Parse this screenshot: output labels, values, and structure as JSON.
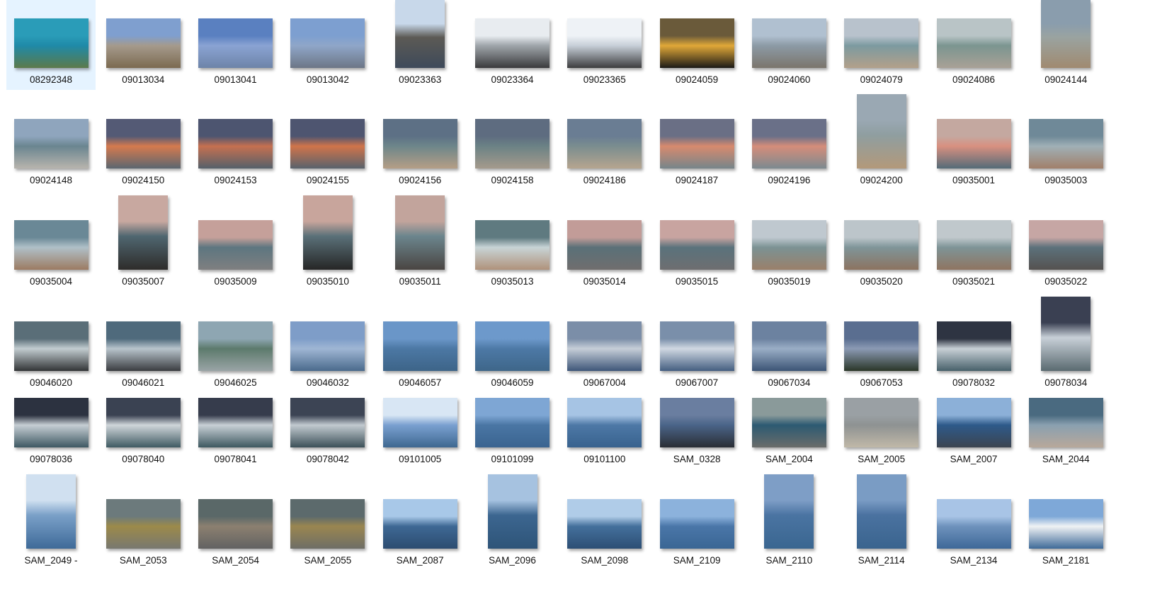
{
  "view": "large-icons",
  "selected_index": 0,
  "rows": [
    [
      [
        "08292348",
        "l",
        [
          "#2a9cb8",
          "#1f8aa8",
          "#5d7a4a"
        ]
      ],
      [
        "09013034",
        "l",
        [
          "#7f9fcf",
          "#a59a8c",
          "#7b6a50"
        ]
      ],
      [
        "09013041",
        "l",
        [
          "#5a80c0",
          "#8aa3d3",
          "#6d84a8"
        ]
      ],
      [
        "09013042",
        "l",
        [
          "#7d9fd0",
          "#8fa6c8",
          "#6c7686"
        ]
      ],
      [
        "09023363",
        "p",
        [
          "#c8d8ea",
          "#5c5a55",
          "#3e4a5a"
        ]
      ],
      [
        "09023364",
        "l",
        [
          "#e8ecf0",
          "#9fa5aa",
          "#3a3a3c"
        ]
      ],
      [
        "09023365",
        "l",
        [
          "#eef2f6",
          "#c7cfd8",
          "#3c3c3e"
        ]
      ],
      [
        "09024059",
        "l",
        [
          "#6a5a3a",
          "#e0a838",
          "#1b1a17"
        ]
      ],
      [
        "09024060",
        "l",
        [
          "#b0c0d0",
          "#8c9aa5",
          "#7b756c"
        ]
      ],
      [
        "09024079",
        "l",
        [
          "#b8c2cc",
          "#7c9aa0",
          "#b3a08a"
        ]
      ],
      [
        "09024086",
        "l",
        [
          "#b9c4c6",
          "#7b9590",
          "#a9a196"
        ]
      ],
      [
        "09024144",
        "p",
        [
          "#8a9dad",
          "#9aa3a0",
          "#a08a70"
        ]
      ]
    ],
    [
      [
        "09024148",
        "l",
        [
          "#8fa5bd",
          "#6a8590",
          "#b8b4ad"
        ]
      ],
      [
        "09024150",
        "l",
        [
          "#545a75",
          "#d57a4e",
          "#5b6670"
        ]
      ],
      [
        "09024153",
        "l",
        [
          "#4d5570",
          "#c57050",
          "#55606a"
        ]
      ],
      [
        "09024155",
        "l",
        [
          "#4e5570",
          "#d0744a",
          "#58626c"
        ]
      ],
      [
        "09024156",
        "l",
        [
          "#5d7085",
          "#6d868a",
          "#b59e86"
        ]
      ],
      [
        "09024158",
        "l",
        [
          "#5e6c80",
          "#6b8285",
          "#a59a8c"
        ]
      ],
      [
        "09024186",
        "l",
        [
          "#6a7d93",
          "#7a8d8f",
          "#b6a58f"
        ]
      ],
      [
        "09024187",
        "l",
        [
          "#6a6f85",
          "#d78a6e",
          "#76858a"
        ]
      ],
      [
        "09024196",
        "l",
        [
          "#6a7088",
          "#d58d7a",
          "#7c8a90"
        ]
      ],
      [
        "09024200",
        "p",
        [
          "#9aa8b3",
          "#8f9ea0",
          "#b3997a"
        ]
      ],
      [
        "09035001",
        "l",
        [
          "#c4a8a0",
          "#d89080",
          "#546b78"
        ]
      ],
      [
        "09035003",
        "l",
        [
          "#6f8998",
          "#a0b0b6",
          "#a1806a"
        ]
      ]
    ],
    [
      [
        "09035004",
        "l",
        [
          "#6a8896",
          "#b0c0c8",
          "#9c7b62"
        ]
      ],
      [
        "09035007",
        "p",
        [
          "#c8a8a0",
          "#4f6670",
          "#2e2c2a"
        ]
      ],
      [
        "09035009",
        "l",
        [
          "#c5a09a",
          "#5d7680",
          "#7f7f80"
        ]
      ],
      [
        "09035010",
        "p",
        [
          "#c8a59c",
          "#5a7078",
          "#262626"
        ]
      ],
      [
        "09035011",
        "p",
        [
          "#c2a49c",
          "#6b858d",
          "#4a4542"
        ]
      ],
      [
        "09035013",
        "l",
        [
          "#5f7a80",
          "#c8d4d6",
          "#b0927b"
        ]
      ],
      [
        "09035014",
        "l",
        [
          "#c29c98",
          "#5a7078",
          "#706e6e"
        ]
      ],
      [
        "09035015",
        "l",
        [
          "#c8a4a0",
          "#5a727c",
          "#6e6e70"
        ]
      ],
      [
        "09035019",
        "l",
        [
          "#bfc8cf",
          "#7b9294",
          "#9a806a"
        ]
      ],
      [
        "09035020",
        "l",
        [
          "#bcc5ca",
          "#7f9599",
          "#8c7360"
        ]
      ],
      [
        "09035021",
        "l",
        [
          "#c0c8cc",
          "#7e9497",
          "#8f7561"
        ]
      ],
      [
        "09035022",
        "l",
        [
          "#c6a6a4",
          "#5c717b",
          "#555250"
        ]
      ]
    ],
    [
      [
        "09046020",
        "l",
        [
          "#5a6e78",
          "#c2ccd0",
          "#323436"
        ]
      ],
      [
        "09046021",
        "l",
        [
          "#4f6a7c",
          "#b8c4cc",
          "#3a3c40"
        ]
      ],
      [
        "09046025",
        "l",
        [
          "#8ea6b2",
          "#5c7a6c",
          "#9aa4a6"
        ]
      ],
      [
        "09046032",
        "l",
        [
          "#7e9dc8",
          "#9fb6d4",
          "#4a6a8c"
        ]
      ],
      [
        "09046057",
        "l",
        [
          "#6a96c8",
          "#4c78a4",
          "#3d6488"
        ]
      ],
      [
        "09046059",
        "l",
        [
          "#6d99cb",
          "#4d79a6",
          "#3e6689"
        ]
      ],
      [
        "09067004",
        "l",
        [
          "#7b8ea8",
          "#c6ced8",
          "#3e5678"
        ]
      ],
      [
        "09067007",
        "l",
        [
          "#7a8faa",
          "#d0d8e2",
          "#445e80"
        ]
      ],
      [
        "09067034",
        "l",
        [
          "#6c82a0",
          "#9aaec6",
          "#3b5475"
        ]
      ],
      [
        "09067053",
        "l",
        [
          "#5a6e90",
          "#8b9ab4",
          "#2a3628"
        ]
      ],
      [
        "09078032",
        "l",
        [
          "#2e3442",
          "#c8d0d6",
          "#47606a"
        ]
      ],
      [
        "09078034",
        "p",
        [
          "#3a4052",
          "#c8d0d8",
          "#5a6a70"
        ]
      ]
    ],
    [
      [
        "09078036",
        "l",
        [
          "#2c3240",
          "#c6ced4",
          "#3e5862"
        ]
      ],
      [
        "09078040",
        "l",
        [
          "#3a4252",
          "#d0d6da",
          "#3f5a62"
        ]
      ],
      [
        "09078041",
        "l",
        [
          "#363c4c",
          "#c8d0d6",
          "#3e5860"
        ]
      ],
      [
        "09078042",
        "l",
        [
          "#3c4454",
          "#c2cad0",
          "#3c5058"
        ]
      ],
      [
        "09101005",
        "l",
        [
          "#d8e6f4",
          "#7aa0d0",
          "#3e6890"
        ]
      ],
      [
        "09101099",
        "l",
        [
          "#7ea6d4",
          "#4a76a4",
          "#3a6490"
        ]
      ],
      [
        "09101100",
        "l",
        [
          "#a6c4e4",
          "#4d78a6",
          "#38628e"
        ]
      ],
      [
        "SAM_0328",
        "l",
        [
          "#6a7ea0",
          "#4a6488",
          "#2a2e34"
        ]
      ],
      [
        "SAM_2004",
        "l",
        [
          "#8a9a9a",
          "#2c5a72",
          "#6a6c6a"
        ]
      ],
      [
        "SAM_2005",
        "l",
        [
          "#9aa0a4",
          "#8e9292",
          "#c0b8a8"
        ]
      ],
      [
        "SAM_2007",
        "l",
        [
          "#8cb0d8",
          "#2e5a8a",
          "#3c4450"
        ]
      ],
      [
        "SAM_2044",
        "l",
        [
          "#4a6a80",
          "#8aa0b0",
          "#b8a89a"
        ]
      ]
    ],
    [
      [
        "SAM_2049 -",
        "p",
        [
          "#d0e0f0",
          "#7aa0c8",
          "#3e6a98"
        ]
      ],
      [
        "SAM_2053",
        "l",
        [
          "#6c7a7c",
          "#9c8a4a",
          "#787870"
        ]
      ],
      [
        "SAM_2054",
        "l",
        [
          "#5a6868",
          "#8c8070",
          "#626262"
        ]
      ],
      [
        "SAM_2055",
        "l",
        [
          "#5c6a6c",
          "#9a8650",
          "#6e6e66"
        ]
      ],
      [
        "SAM_2087",
        "l",
        [
          "#a8c8e8",
          "#3e6894",
          "#2c4c70"
        ]
      ],
      [
        "SAM_2096",
        "p",
        [
          "#a6c2e0",
          "#3c6690",
          "#2e5478"
        ]
      ],
      [
        "SAM_2098",
        "l",
        [
          "#b0cce8",
          "#44709c",
          "#2c4e74"
        ]
      ],
      [
        "SAM_2109",
        "l",
        [
          "#8cb2dc",
          "#4a76a8",
          "#3a6694"
        ]
      ],
      [
        "SAM_2110",
        "p",
        [
          "#7e9ec6",
          "#4a74a2",
          "#3a6690"
        ]
      ],
      [
        "SAM_2114",
        "p",
        [
          "#7a9cc4",
          "#4a72a0",
          "#3a648e"
        ]
      ],
      [
        "SAM_2134",
        "l",
        [
          "#a8c4e6",
          "#6e92bc",
          "#3e6898"
        ]
      ],
      [
        "SAM_2181",
        "l",
        [
          "#7ea8d8",
          "#f0f2f4",
          "#3e6a98"
        ]
      ]
    ]
  ]
}
